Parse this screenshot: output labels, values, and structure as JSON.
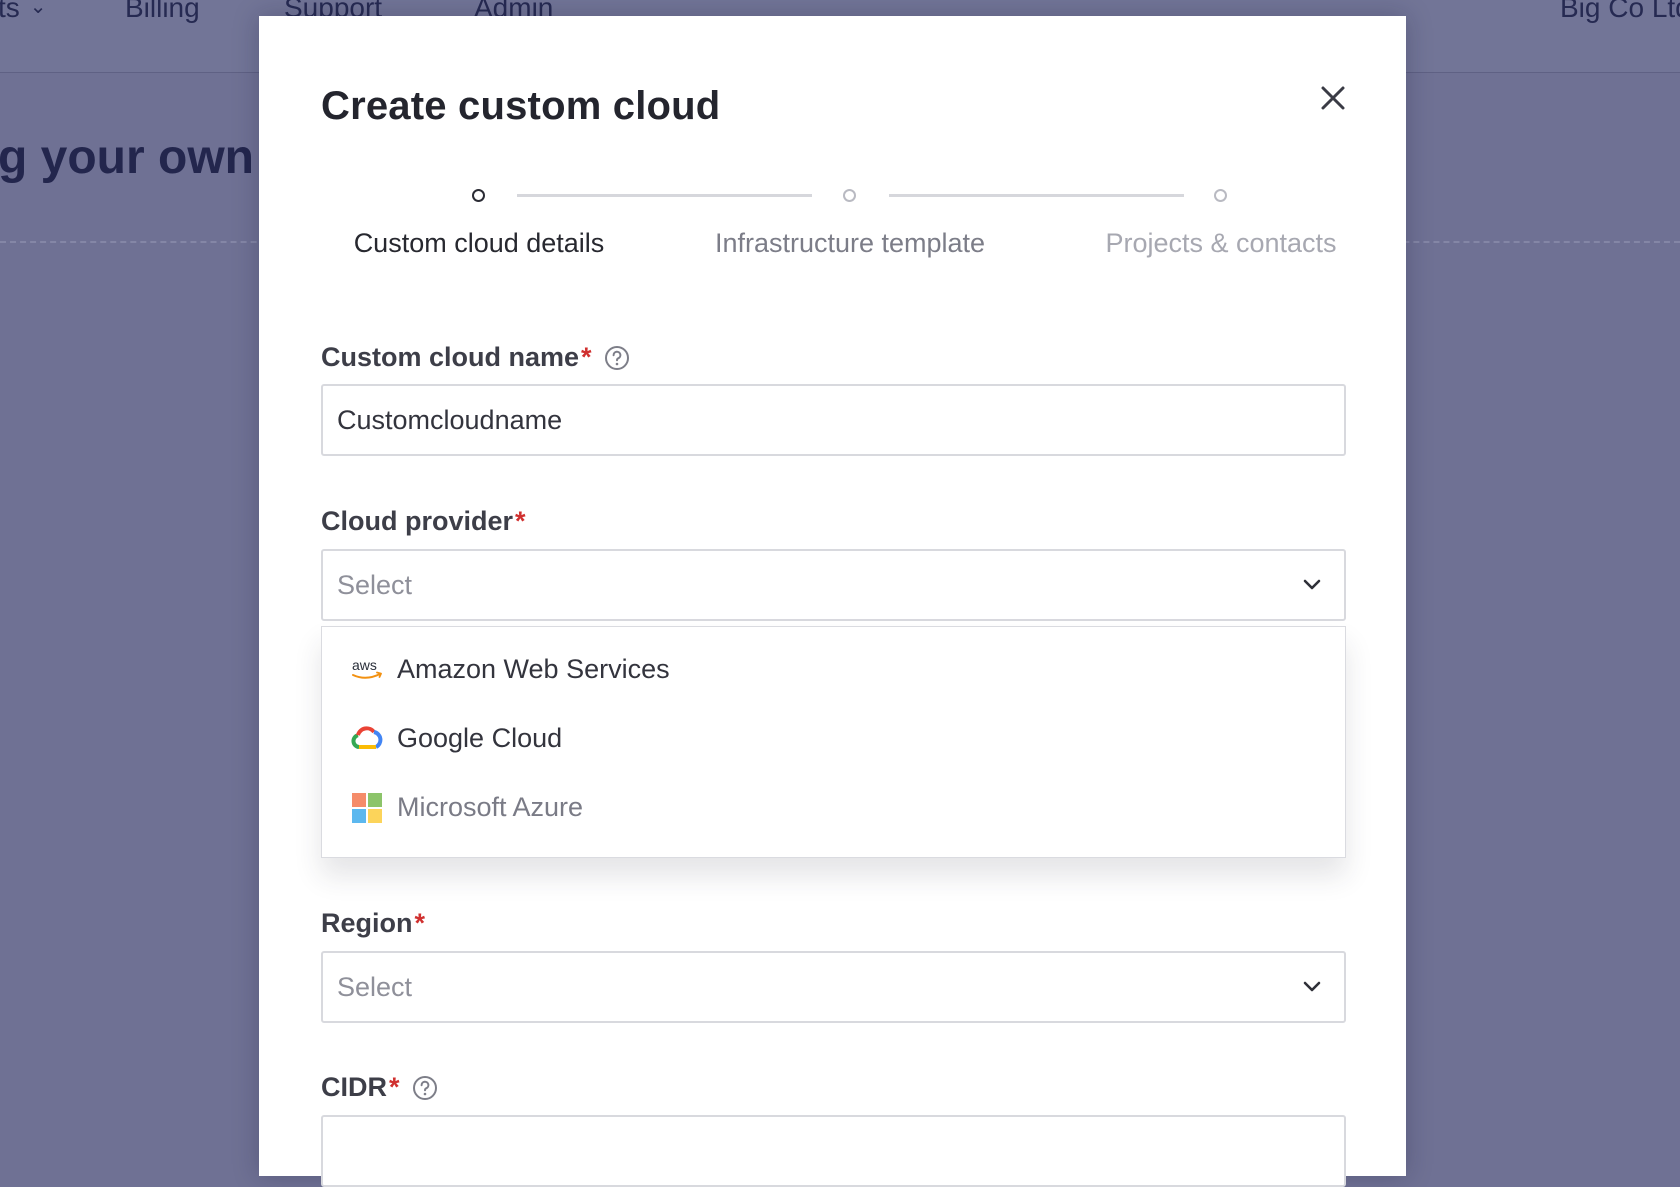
{
  "background": {
    "nav": [
      {
        "label": "ts"
      },
      {
        "label": "Billing"
      },
      {
        "label": "Support"
      },
      {
        "label": "Admin"
      },
      {
        "label": "Big Co Ltd"
      }
    ],
    "heading": "g your own"
  },
  "modal": {
    "title": "Create custom cloud",
    "steps": [
      {
        "label": "Custom cloud details",
        "state": "active"
      },
      {
        "label": "Infrastructure template",
        "state": "inactive"
      },
      {
        "label": "Projects & contacts",
        "state": "inactive"
      }
    ],
    "fields": {
      "name": {
        "label": "Custom cloud name",
        "required": "*",
        "value": "Customcloudname"
      },
      "provider": {
        "label": "Cloud provider",
        "required": "*",
        "placeholder": "Select"
      },
      "region": {
        "label": "Region",
        "required": "*",
        "placeholder": "Select"
      },
      "cidr": {
        "label": "CIDR",
        "required": "*",
        "value": ""
      }
    },
    "provider_options": [
      {
        "label": "Amazon Web Services",
        "icon": "aws-logo-icon",
        "logo_text": "aws"
      },
      {
        "label": "Google Cloud",
        "icon": "google-cloud-logo-icon"
      },
      {
        "label": "Microsoft Azure",
        "icon": "microsoft-logo-icon"
      }
    ]
  },
  "colors": {
    "overlay": "#6f7194",
    "required": "#d0302f",
    "text_primary": "#24252e",
    "border": "#d8d9de"
  }
}
